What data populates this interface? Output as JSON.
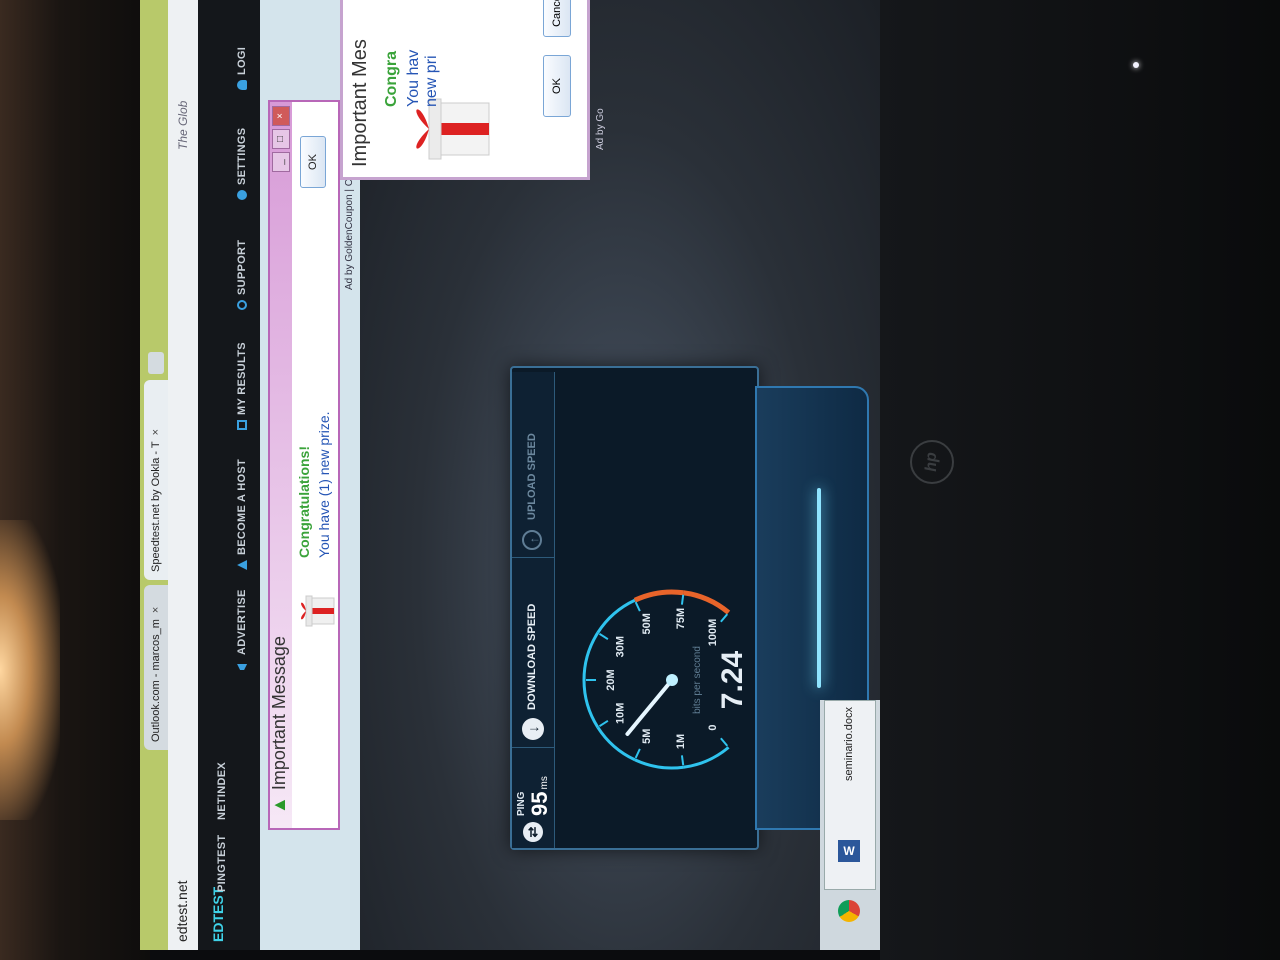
{
  "browser": {
    "tabs": [
      {
        "label": "Outlook.com - marcos_m",
        "close": "×"
      },
      {
        "label": "Speedtest.net by Ookla - T",
        "close": "×"
      }
    ],
    "url": "edtest.net",
    "tagline": "The Glob"
  },
  "site": {
    "logo": "EDTEST",
    "nav_top": [
      "PINGTEST",
      "NETINDEX"
    ],
    "nav": [
      {
        "label": "ADVERTISE",
        "icon": "megaphone-icon"
      },
      {
        "label": "BECOME A HOST",
        "icon": "triangle-icon"
      },
      {
        "label": "MY RESULTS",
        "icon": "chart-icon"
      },
      {
        "label": "SUPPORT",
        "icon": "info-icon"
      },
      {
        "label": "SETTINGS",
        "icon": "gear-icon"
      },
      {
        "label": "LOGI",
        "icon": "person-icon"
      }
    ]
  },
  "ad": {
    "title": "Important Message",
    "congrats": "Congratulations!",
    "prize": "You have (1) new prize.",
    "ok": "OK",
    "credit": "Ad by GoldenCoupon | Close"
  },
  "speedtest": {
    "ping_label": "PING",
    "ping_value": "95",
    "ping_unit": "ms",
    "download_label": "DOWNLOAD SPEED",
    "upload_label": "UPLOAD SPEED",
    "speed_value": "7.24",
    "unit_label": "bits per second",
    "scale_labels": [
      "0",
      "1M",
      "5M",
      "10M",
      "20M",
      "30M",
      "50M",
      "75M",
      "100M"
    ],
    "accent_color": "#2fc3ee",
    "warning_color": "#e8642a"
  },
  "popup2": {
    "title": "Important Mes",
    "congrats": "Congra",
    "prize_line1": "You hav",
    "prize_line2": "new pri",
    "ok": "OK",
    "cancel": "Cance",
    "credit": "Ad by Go"
  },
  "downloads": {
    "file": "seminario.docx"
  }
}
